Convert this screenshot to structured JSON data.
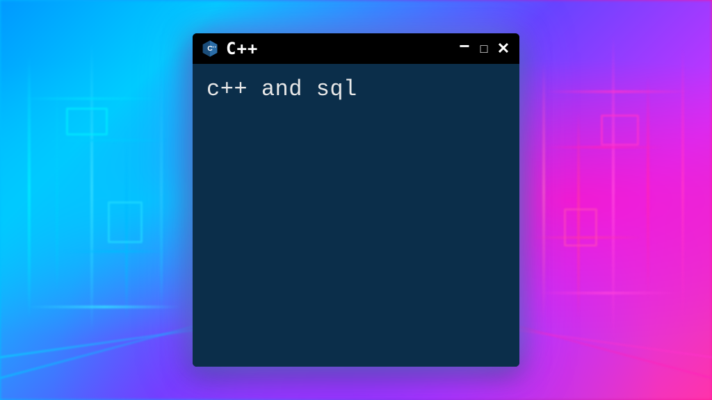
{
  "window": {
    "title": "C++",
    "icon_name": "cpp-logo-icon"
  },
  "terminal": {
    "content": "c++ and sql"
  },
  "colors": {
    "terminal_bg": "#0b2e4a",
    "titlebar_bg": "#000000",
    "text": "#e8e8e8"
  }
}
